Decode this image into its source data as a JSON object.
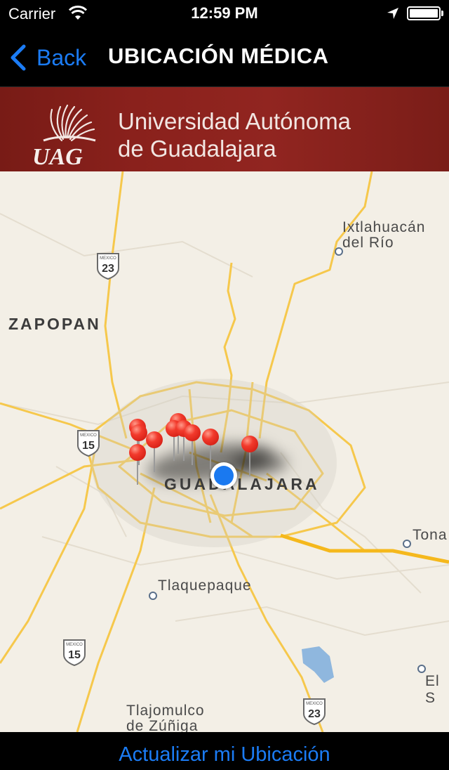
{
  "status_bar": {
    "carrier": "Carrier",
    "time": "12:59 PM",
    "icons": [
      "wifi-icon",
      "location-arrow-icon",
      "battery-icon"
    ]
  },
  "nav": {
    "back_label": "Back",
    "title": "UBICACIÓN MÉDICA"
  },
  "banner": {
    "logo_text": "UAG",
    "line1": "Universidad Autónoma",
    "line2": "de Guadalajara"
  },
  "map": {
    "labels": {
      "ixtlahuacan_1": "Ixtlahuacán",
      "ixtlahuacan_2": "del Río",
      "zapopan": "ZAPOPAN",
      "guadalajara": "GUADALAJARA",
      "tonala": "Tona",
      "tlaquepaque": "Tlaquepaque",
      "el_salto": "El S",
      "tlajomulco_1": "Tlajomulco",
      "tlajomulco_2": "de Zúñiga"
    },
    "shields": [
      {
        "country": "MEXICO",
        "number": "23"
      },
      {
        "country": "MEXICO",
        "number": "15"
      },
      {
        "country": "MEXICO",
        "number": "15"
      },
      {
        "country": "MEXICO",
        "number": "23"
      }
    ],
    "pin_color": "#e8291c",
    "user_location_color": "#1a79f0"
  },
  "toolbar": {
    "update_label": "Actualizar mi Ubicación"
  },
  "colors": {
    "accent": "#1b7cf5",
    "banner": "#8a211c",
    "map_bg": "#f3efe6",
    "road": "#f6c343"
  }
}
